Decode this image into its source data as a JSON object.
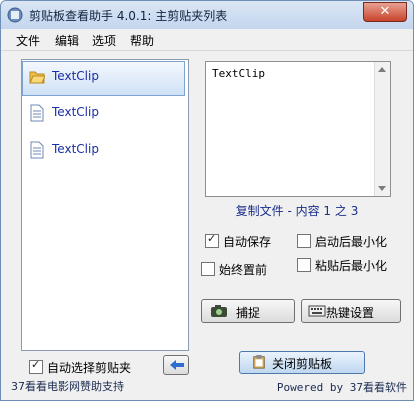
{
  "window": {
    "title": "剪贴板查看助手 4.0.1: 主剪贴夹列表",
    "close_symbol": "✕"
  },
  "menu": [
    "文件",
    "编辑",
    "选项",
    "帮助"
  ],
  "clips": [
    {
      "label": "TextClip",
      "icon": "folder-open-icon",
      "selected": true
    },
    {
      "label": "TextClip",
      "icon": "text-file-icon",
      "selected": false
    },
    {
      "label": "TextClip",
      "icon": "text-file-icon",
      "selected": false
    }
  ],
  "preview": {
    "text": "TextClip"
  },
  "status": "复制文件 - 内容 1 之 3",
  "options": {
    "auto_save": {
      "label": "自动保存",
      "checked": true
    },
    "minimize_after_start": {
      "label": "启动后最小化",
      "checked": false
    },
    "always_on_top": {
      "label": "始终置前",
      "checked": false
    },
    "minimize_after_paste": {
      "label": "粘贴后最小化",
      "checked": false
    }
  },
  "buttons": {
    "capture": "捕捉",
    "hotkey_settings": "热键设置",
    "close_clipboard": "关闭剪贴板"
  },
  "auto_select": {
    "label": "自动选择剪贴夹",
    "checked": true
  },
  "footer": {
    "left": "37看看电影网赞助支持",
    "right": "Powered by 37看看软件"
  },
  "colors": {
    "link_blue": "#1a2ea8",
    "status_blue": "#1a2e8a"
  }
}
